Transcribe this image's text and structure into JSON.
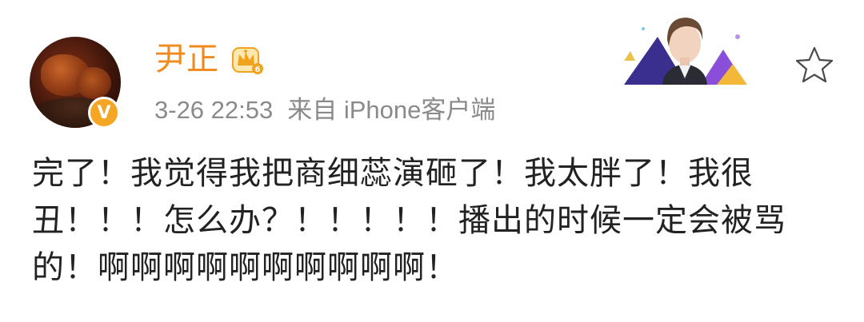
{
  "post": {
    "username": "尹正",
    "timestamp": "3-26 22:53",
    "source": "来自 iPhone客户端",
    "verified_badge": "V",
    "vip_level": "6",
    "content_lines": [
      "完了！我觉得我把商细蕊演砸了！我太胖了！我很",
      "丑！！！怎么办？！！！！！播出的时候一定会被骂",
      "的！啊啊啊啊啊啊啊啊啊啊！"
    ]
  },
  "icons": {
    "verified": "verified-v-icon",
    "vip": "vip-crown-icon",
    "favorite": "star-outline-icon"
  },
  "colors": {
    "username": "#f08a1c",
    "meta": "#8a8a8a",
    "text": "#222222",
    "verified": "#f5a623"
  }
}
